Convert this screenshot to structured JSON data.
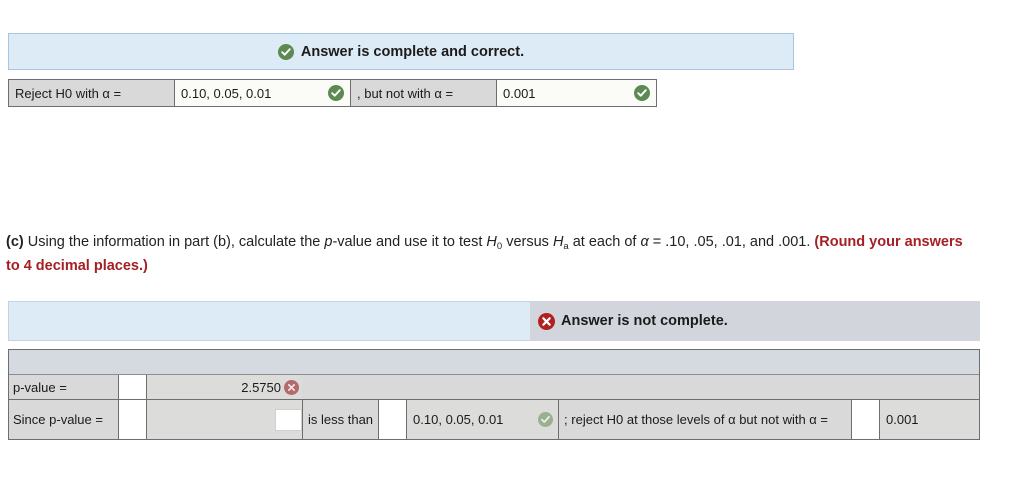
{
  "part_b_result": {
    "banner": {
      "icon": "check-circle-icon",
      "text": "Answer is complete and correct.",
      "bg_color": "#ddebf7"
    },
    "row": {
      "label_1": "Reject H0 with α =",
      "answer_1": "0.10, 0.05, 0.01",
      "answer_1_icon": "check-circle-icon",
      "label_2": ", but not with α =",
      "answer_2": "0.001",
      "answer_2_icon": "check-circle-icon"
    }
  },
  "question_c": {
    "part_marker": "(c)",
    "text_1": " Using the information in part (b), calculate the ",
    "p_italic": "p",
    "text_2": "-value and use it to test ",
    "h0": "H",
    "h0_sub": "0",
    "text_3": " versus ",
    "ha": "H",
    "ha_sub": "a",
    "text_4": " at each of ",
    "alpha": "α",
    "text_5": " = .10, .05, .01, and .001. ",
    "rounding_note": "(Round your answers to 4 decimal places.)"
  },
  "part_c_result": {
    "banner": {
      "icon": "x-circle-icon",
      "text": "Answer is not complete.",
      "bg_left_color": "#ddebf7",
      "bg_right_color": "#d2d6dc",
      "icon_color": "#b02020"
    },
    "rows": [
      {
        "label": "p-value =",
        "input_value": "",
        "value": "2.5750",
        "value_icon": "x-circle-icon"
      },
      {
        "label": "Since p-value =",
        "input_value": "",
        "value": "",
        "text_mid": "is less than",
        "input_value_2": "",
        "option_value": "0.10, 0.05, 0.01",
        "option_icon": "check-circle-icon",
        "text_tail": "; reject H0 at those levels of α but not with α =",
        "input_value_3": "",
        "final_value": "0.001"
      }
    ]
  },
  "colors": {
    "check_green": "#5c8a52",
    "x_red": "#b02020",
    "x_red_muted": "#b4696b",
    "banner_blue": "#ddebf7",
    "cell_grey": "#d9d9d9"
  }
}
